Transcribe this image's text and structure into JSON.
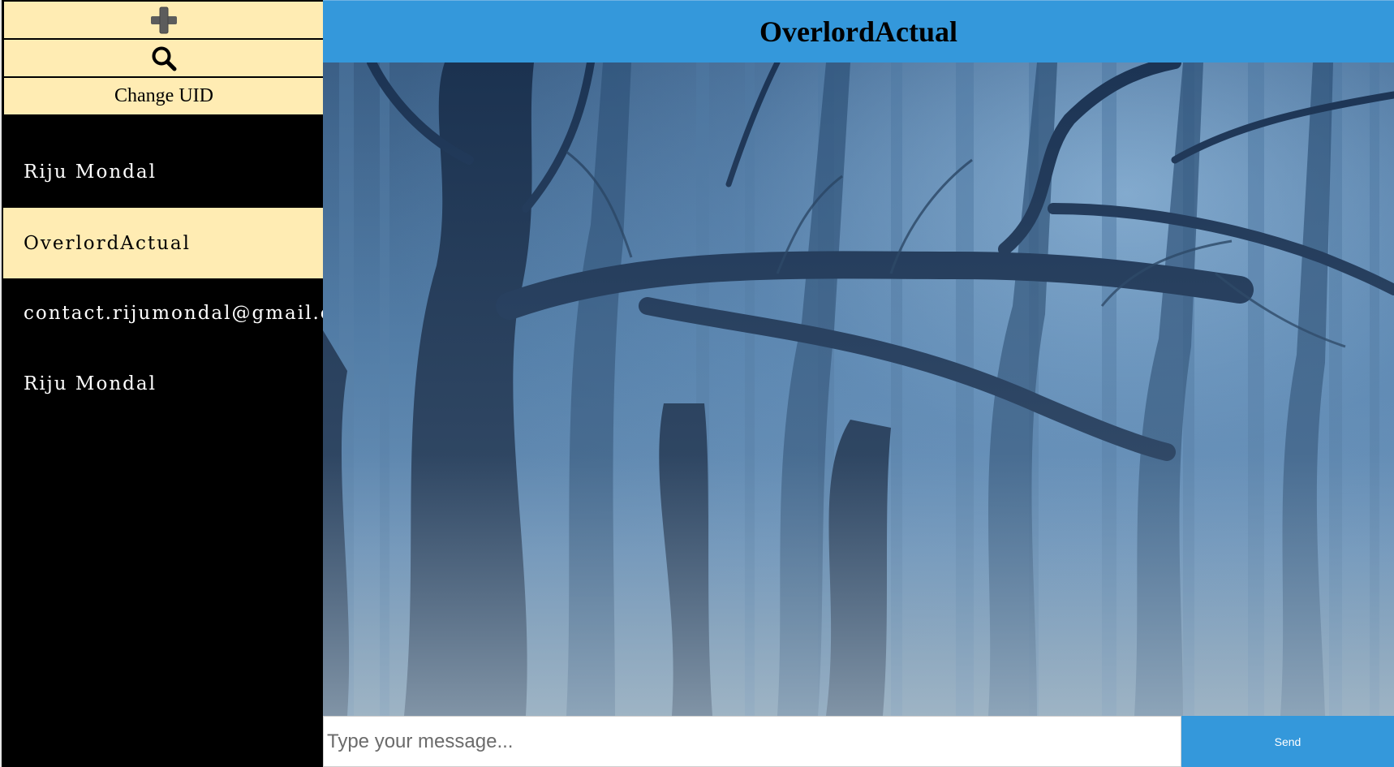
{
  "sidebar": {
    "add_icon": "plus-icon",
    "search_icon": "magnifier-icon",
    "change_uid_label": "Change UID",
    "contacts": [
      {
        "name": "Riju Mondal",
        "active": false
      },
      {
        "name": "OverlordActual",
        "active": true
      },
      {
        "name": "contact.rijumondal@gmail.com",
        "active": false
      },
      {
        "name": "Riju Mondal",
        "active": false
      }
    ]
  },
  "header": {
    "title": "OverlordActual"
  },
  "composer": {
    "placeholder": "Type your message...",
    "value": "",
    "send_label": "Send"
  },
  "colors": {
    "accent": "#3498db",
    "sidebar_button": "#ffecb3",
    "sidebar_bg": "#000000"
  }
}
